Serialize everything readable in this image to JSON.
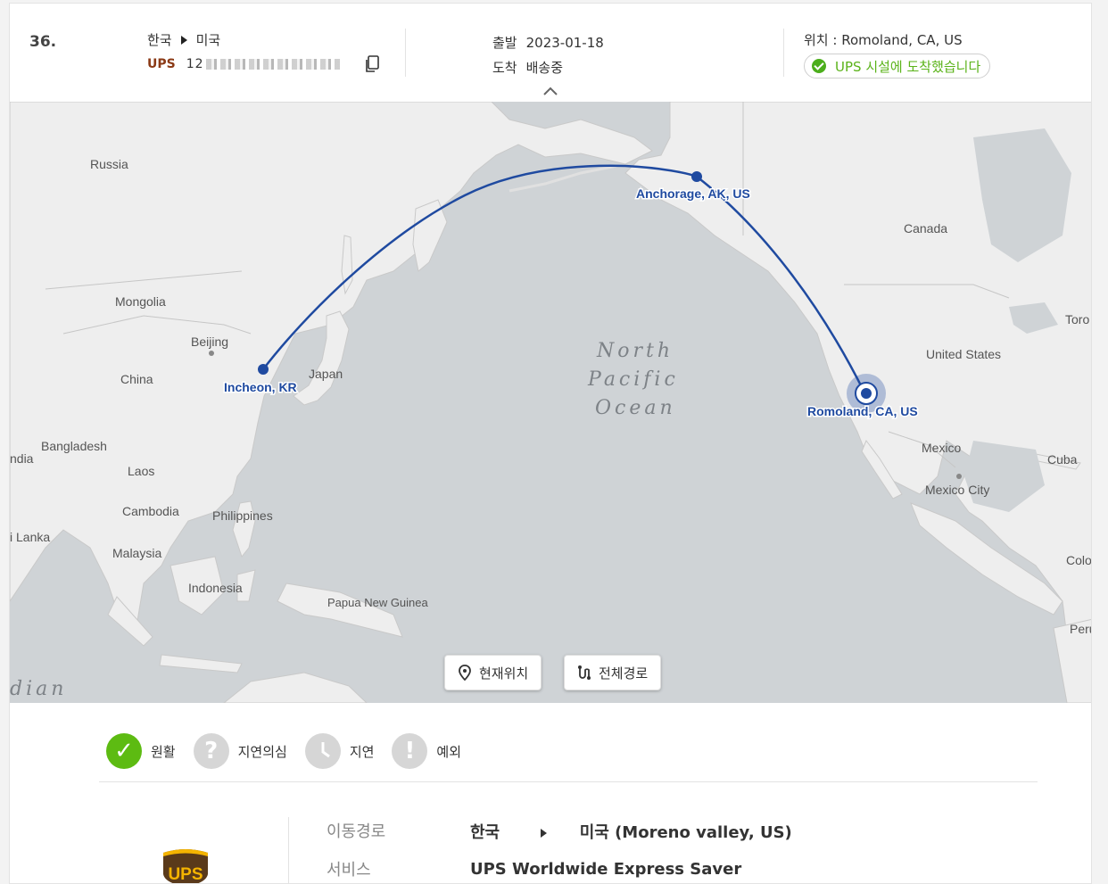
{
  "header": {
    "index": "36.",
    "origin": "한국",
    "destination": "미국",
    "carrier": "UPS",
    "tracking_visible": "12",
    "depart_label": "출발",
    "depart_date": "2023-01-18",
    "arrive_label": "도착",
    "arrive_status": "배송중",
    "location": "위치 : Romoland, CA, US",
    "status": "UPS 시설에 도착했습니다"
  },
  "map": {
    "labels": {
      "russia": "Russia",
      "mongolia": "Mongolia",
      "beijing": "Beijing",
      "china": "China",
      "japan": "Japan",
      "bangladesh": "Bangladesh",
      "india": "ndia",
      "laos": "Laos",
      "cambodia": "Cambodia",
      "philippines": "Philippines",
      "sri_lanka": "i Lanka",
      "malaysia": "Malaysia",
      "indonesia": "Indonesia",
      "png": "Papua New Guinea",
      "ocean1": "North",
      "ocean2": "Pacific",
      "ocean3": "Ocean",
      "indian": "dian",
      "canada": "Canada",
      "usa": "United States",
      "toronto": "Toro",
      "mexico": "Mexico",
      "mexico_city": "Mexico City",
      "cuba": "Cuba",
      "colombia": "Colo",
      "peru": "Peru"
    },
    "stops": {
      "incheon": "Incheon, KR",
      "anchorage": "Anchorage, AK, US",
      "romoland": "Romoland, CA, US"
    },
    "current_location_button": "현재위치",
    "full_route_button": "전체경로"
  },
  "legend": [
    {
      "label": "원활",
      "symbol": "✓"
    },
    {
      "label": "지연의심",
      "symbol": "?"
    },
    {
      "label": "지연",
      "symbol": ""
    },
    {
      "label": "예외",
      "symbol": "!"
    }
  ],
  "details": {
    "route_label": "이동경로",
    "route_from": "한국",
    "route_to": "미국 (Moreno valley, US)",
    "service_label": "서비스",
    "service_value": "UPS Worldwide Express Saver",
    "logo_text": "UPS"
  },
  "colors": {
    "route_line": "#1f4aa0",
    "ok_green": "#5dbb12",
    "carrier_brown": "#8b3a16",
    "ups_brown": "#5a3a1a",
    "ups_gold": "#f5b400"
  }
}
